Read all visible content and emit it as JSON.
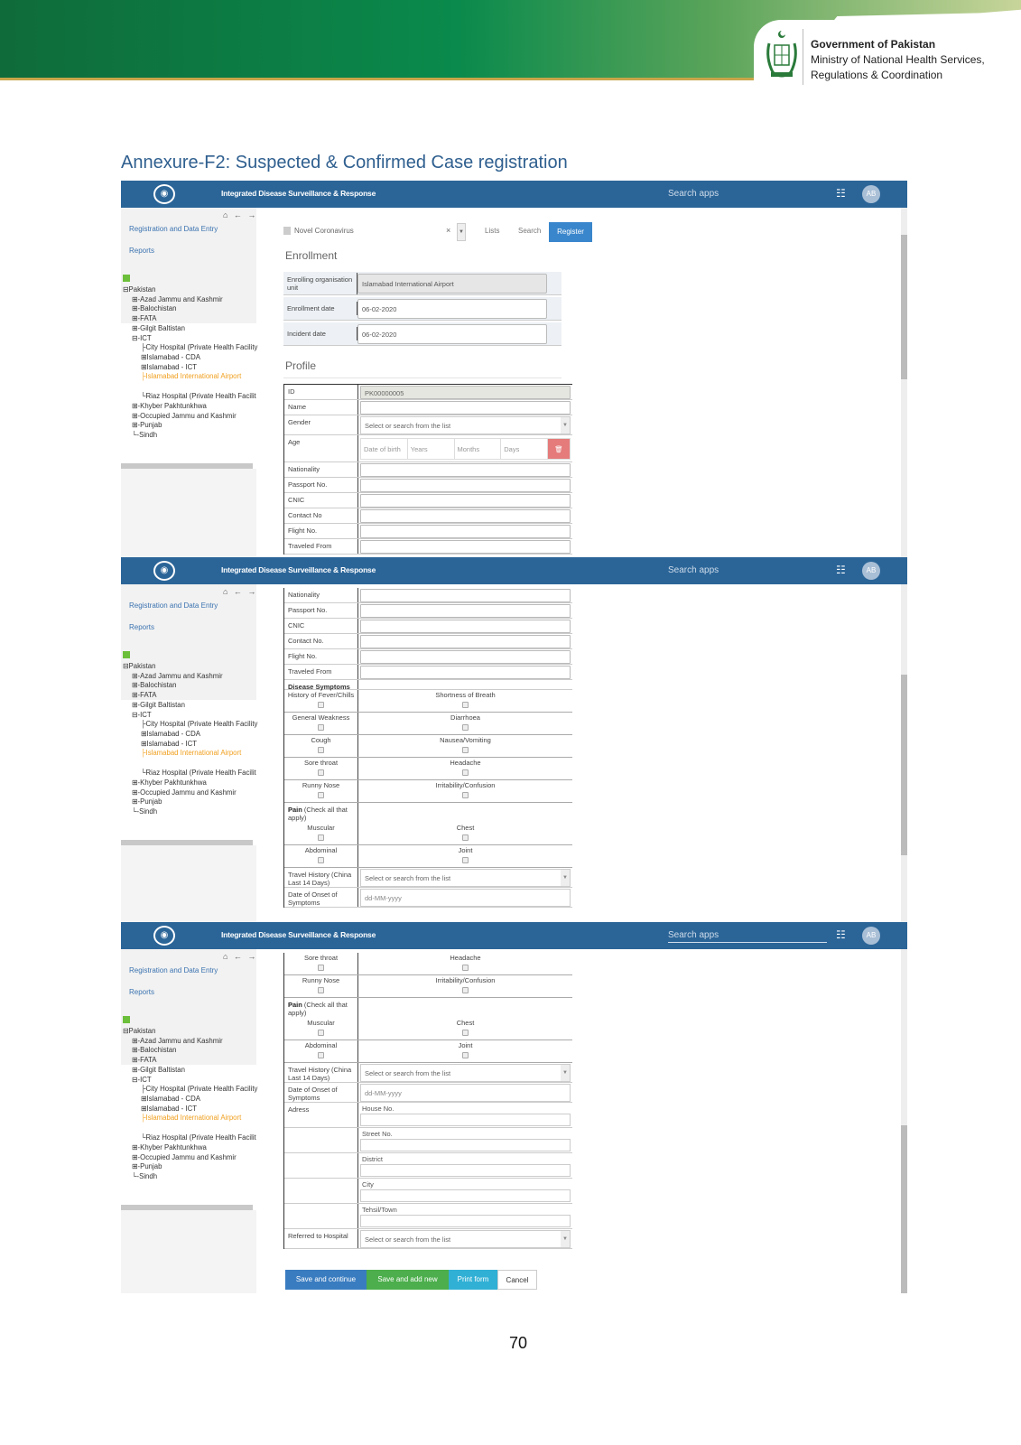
{
  "banner": {
    "gov": "Government of Pakistan",
    "ministry_line1": "Ministry of National Health Services,",
    "ministry_line2": "Regulations & Coordination",
    "colors": {
      "green_dark": "#0f6b3a",
      "green_light": "#c8d59a",
      "gold": "#c9a54a"
    }
  },
  "heading": "Annexure-F2:  Suspected & Confirmed Case registration",
  "page_number": "70",
  "app": {
    "title": "Integrated Disease Surveillance & Response",
    "search_placeholder": "Search apps",
    "avatar": "AB",
    "header_color": "#2b6598",
    "nav_icons": "⌂ ← →",
    "nav": [
      "Registration and Data Entry",
      "Reports"
    ],
    "tree": [
      {
        "label": "⊟Pakistan",
        "level": 0
      },
      {
        "label": "⊞-Azad Jammu and Kashmir",
        "level": 1
      },
      {
        "label": "⊞-Balochistan",
        "level": 1
      },
      {
        "label": "⊞-FATA",
        "level": 1
      },
      {
        "label": "⊞-Gilgit Baltistan",
        "level": 1
      },
      {
        "label": "⊟-ICT",
        "level": 1
      },
      {
        "label": "├City Hospital (Private Health Facility",
        "level": 2
      },
      {
        "label": "⊞Islamabad - CDA",
        "level": 2
      },
      {
        "label": "⊞Islamabad - ICT",
        "level": 2
      },
      {
        "label": "├Islamabad International Airport",
        "level": 2,
        "selected": true
      },
      {
        "label": "└Riaz Hospital (Private Health Facilit",
        "level": 2
      },
      {
        "label": "⊞-Khyber Pakhtunkhwa",
        "level": 1
      },
      {
        "label": "⊞-Occupied Jammu and Kashmir",
        "level": 1
      },
      {
        "label": "⊞-Punjab",
        "level": 1
      },
      {
        "label": "└-Sindh",
        "level": 1
      }
    ]
  },
  "panel1": {
    "program": "Novel Coronavirus",
    "clear": "×",
    "links": [
      "Lists",
      "Search"
    ],
    "register": "Register",
    "enrollment_title": "Enrollment",
    "enrollment": [
      {
        "label": "Enrolling organisation unit",
        "value": "Islamabad International Airport",
        "readonly": true
      },
      {
        "label": "Enrollment date",
        "value": "06-02-2020"
      },
      {
        "label": "Incident date",
        "value": "06-02-2020"
      }
    ],
    "profile_title": "Profile",
    "rows": [
      {
        "type": "fld",
        "label": "ID",
        "value": "PK00000005",
        "readonly": true
      },
      {
        "type": "fld",
        "label": "Name"
      },
      {
        "type": "sel",
        "label": "Gender",
        "value": "Select or search from the list"
      },
      {
        "type": "age",
        "label": "Age",
        "parts": [
          "Date of birth",
          "Years",
          "Months",
          "Days"
        ]
      },
      {
        "type": "fld",
        "label": "Nationality"
      },
      {
        "type": "fld",
        "label": "Passport No."
      },
      {
        "type": "fld",
        "label": "CNIC"
      },
      {
        "type": "fld",
        "label": "Contact No"
      },
      {
        "type": "fld",
        "label": "Flight No."
      },
      {
        "type": "fld",
        "label": "Traveled From"
      }
    ]
  },
  "panel2": {
    "rows": [
      {
        "type": "fld",
        "label": "Nationality"
      },
      {
        "type": "fld",
        "label": "Passport No."
      },
      {
        "type": "fld",
        "label": "CNIC"
      },
      {
        "type": "fld",
        "label": "Contact No."
      },
      {
        "type": "fld",
        "label": "Flight No."
      },
      {
        "type": "fld",
        "label": "Traveled From"
      },
      {
        "type": "sec",
        "label": "Disease Symptoms"
      },
      {
        "type": "sym",
        "a": "History of Fever/Chills",
        "b": "Shortness of Breath"
      },
      {
        "type": "sym",
        "a": "General Weakness",
        "b": "Diarrhoea"
      },
      {
        "type": "sym",
        "a": "Cough",
        "b": "Nausea/Vomiting"
      },
      {
        "type": "sym",
        "a": "Sore throat",
        "b": "Headache"
      },
      {
        "type": "sym",
        "a": "Runny Nose",
        "b": "Irritability/Confusion"
      },
      {
        "type": "pain",
        "bold": "Pain",
        "label": " (Check all that apply)"
      },
      {
        "type": "sym",
        "a": "Muscular",
        "b": "Chest"
      },
      {
        "type": "sym",
        "a": "Abdominal",
        "b": "Joint"
      },
      {
        "type": "sel",
        "label": "Travel History (China Last 14 Days)",
        "value": "Select or search from the list"
      },
      {
        "type": "dt",
        "label": "Date of Onset of Symptoms",
        "value": "dd-MM-yyyy"
      }
    ]
  },
  "panel3": {
    "rows": [
      {
        "type": "sym",
        "a": "Sore throat",
        "b": "Headache"
      },
      {
        "type": "sym",
        "a": "Runny Nose",
        "b": "Irritability/Confusion"
      },
      {
        "type": "pain",
        "bold": "Pain",
        "label": " (Check all that apply)"
      },
      {
        "type": "sym",
        "a": "Muscular",
        "b": "Chest"
      },
      {
        "type": "sym",
        "a": "Abdominal",
        "b": "Joint"
      },
      {
        "type": "sel",
        "label": "Travel History (China Last 14 Days)",
        "value": "Select or search from the list"
      },
      {
        "type": "dt",
        "label": "Date of Onset of Symptoms",
        "value": "dd-MM-yyyy"
      },
      {
        "type": "addr",
        "label": "Adress",
        "caption": "House No."
      },
      {
        "type": "addr",
        "label": "",
        "caption": "Street No."
      },
      {
        "type": "addr",
        "label": "",
        "caption": "District"
      },
      {
        "type": "addr",
        "label": "",
        "caption": "City"
      },
      {
        "type": "addr",
        "label": "",
        "caption": "Tehsil/Town"
      },
      {
        "type": "sel",
        "label": "Referred to Hospital",
        "value": "Select or search from the list"
      }
    ],
    "buttons": [
      "Save and continue",
      "Save and add new",
      "Print form",
      "Cancel"
    ]
  }
}
